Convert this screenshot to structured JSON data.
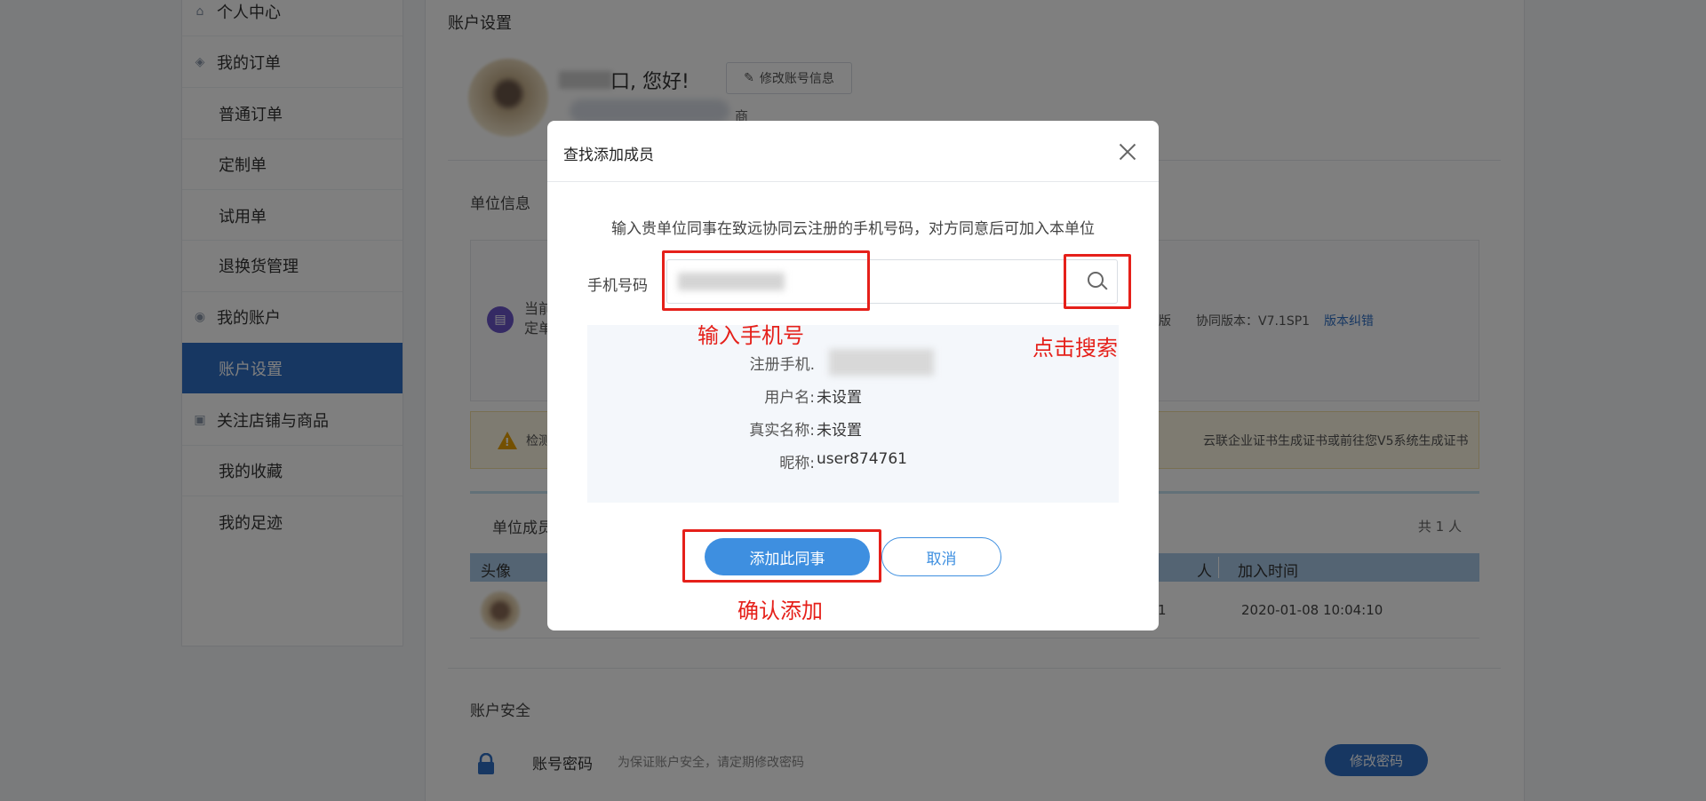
{
  "sidebar": {
    "items": [
      {
        "label": "个人中心",
        "icon": "home-icon"
      },
      {
        "label": "我的订单",
        "icon": "layers-icon"
      },
      {
        "label": "普通订单"
      },
      {
        "label": "定制单"
      },
      {
        "label": "试用单"
      },
      {
        "label": "退换货管理"
      },
      {
        "label": "我的账户",
        "icon": "account-icon"
      },
      {
        "label": "账户设置",
        "active": true
      },
      {
        "label": "关注店铺与商品",
        "icon": "store-icon"
      },
      {
        "label": "我的收藏"
      },
      {
        "label": "我的足迹"
      }
    ]
  },
  "page": {
    "title": "账户设置",
    "greeting": "口, 您好!",
    "edit_account": "修改账号信息",
    "badge_tail": "商",
    "unit_section": "单位信息",
    "unit_text_line1": "当前",
    "unit_text_line2": "定单",
    "version_prefix": "版",
    "version": "协同版本：V7.1SP1",
    "version_link": "版本纠错",
    "warn_prefix": "检测",
    "warn_suffix": "云联企业证书生成证书或前往您V5系统生成证书",
    "members_title": "单位成员",
    "members_count": "共 1 人",
    "col_avatar": "头像",
    "col_partial": "人",
    "col_join_time": "加入时间",
    "row_partial": "1",
    "row_join_time": "2020-01-08 10:04:10",
    "security_section": "账户安全",
    "password_title": "账号密码",
    "password_hint": "为保证账户安全，请定期修改密码",
    "change_password": "修改密码"
  },
  "modal": {
    "title": "查找添加成员",
    "instruction": "输入贵单位同事在致远协同云注册的手机号码，对方同意后可加入本单位",
    "phone_label": "手机号码",
    "result": {
      "phone_label": "注册手机.",
      "username_label": "用户名:",
      "username_value": "未设置",
      "realname_label": "真实名称:",
      "realname_value": "未设置",
      "nickname_label": "昵称:",
      "nickname_value": "user874761"
    },
    "add_button": "添加此同事",
    "cancel_button": "取消"
  },
  "annotations": {
    "input_phone": "输入手机号",
    "click_search": "点击搜索",
    "confirm_add": "确认添加",
    "color": "#e5201a"
  },
  "colors": {
    "accent": "#2f6fc4",
    "modal_button": "#3e8fe0",
    "warning": "#e9a100"
  }
}
